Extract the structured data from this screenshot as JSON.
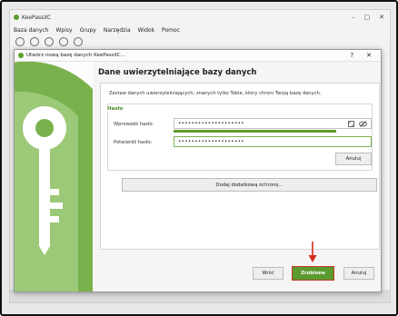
{
  "main": {
    "app_title": "KeePassXC",
    "menu": [
      "Baza danych",
      "Wpisy",
      "Grupy",
      "Narzędzia",
      "Widok",
      "Pomoc"
    ]
  },
  "dialog": {
    "title": "Utwórz nową bazę danych KeePassXC...",
    "help": "?",
    "close": "✕",
    "heading": "Dane uwierzytelniające bazy danych",
    "description": "Zestaw danych uwierzytelniających, znanych tylko Tobie, który chroni Twoją bazę danych.",
    "group_label": "Hasło",
    "password_label": "Wprowadź hasło:",
    "password_value": "••••••••••••••••••••",
    "confirm_label": "Potwierdź hasło:",
    "confirm_value": "••••••••••••••••••••",
    "strength_percent": 82,
    "cancel_field_button": "Anuluj",
    "add_protection_button": "Dodaj dodatkową ochronę...",
    "back_button": "Wróć",
    "done_button": "Zrobione",
    "cancel_button": "Anuluj"
  },
  "colors": {
    "accent": "#5a9a2e",
    "highlight": "#c83a2a"
  },
  "icons": {
    "generator": "password-generator-icon",
    "reveal": "eye-slash-icon",
    "logo": "keepassxc-logo-icon"
  }
}
